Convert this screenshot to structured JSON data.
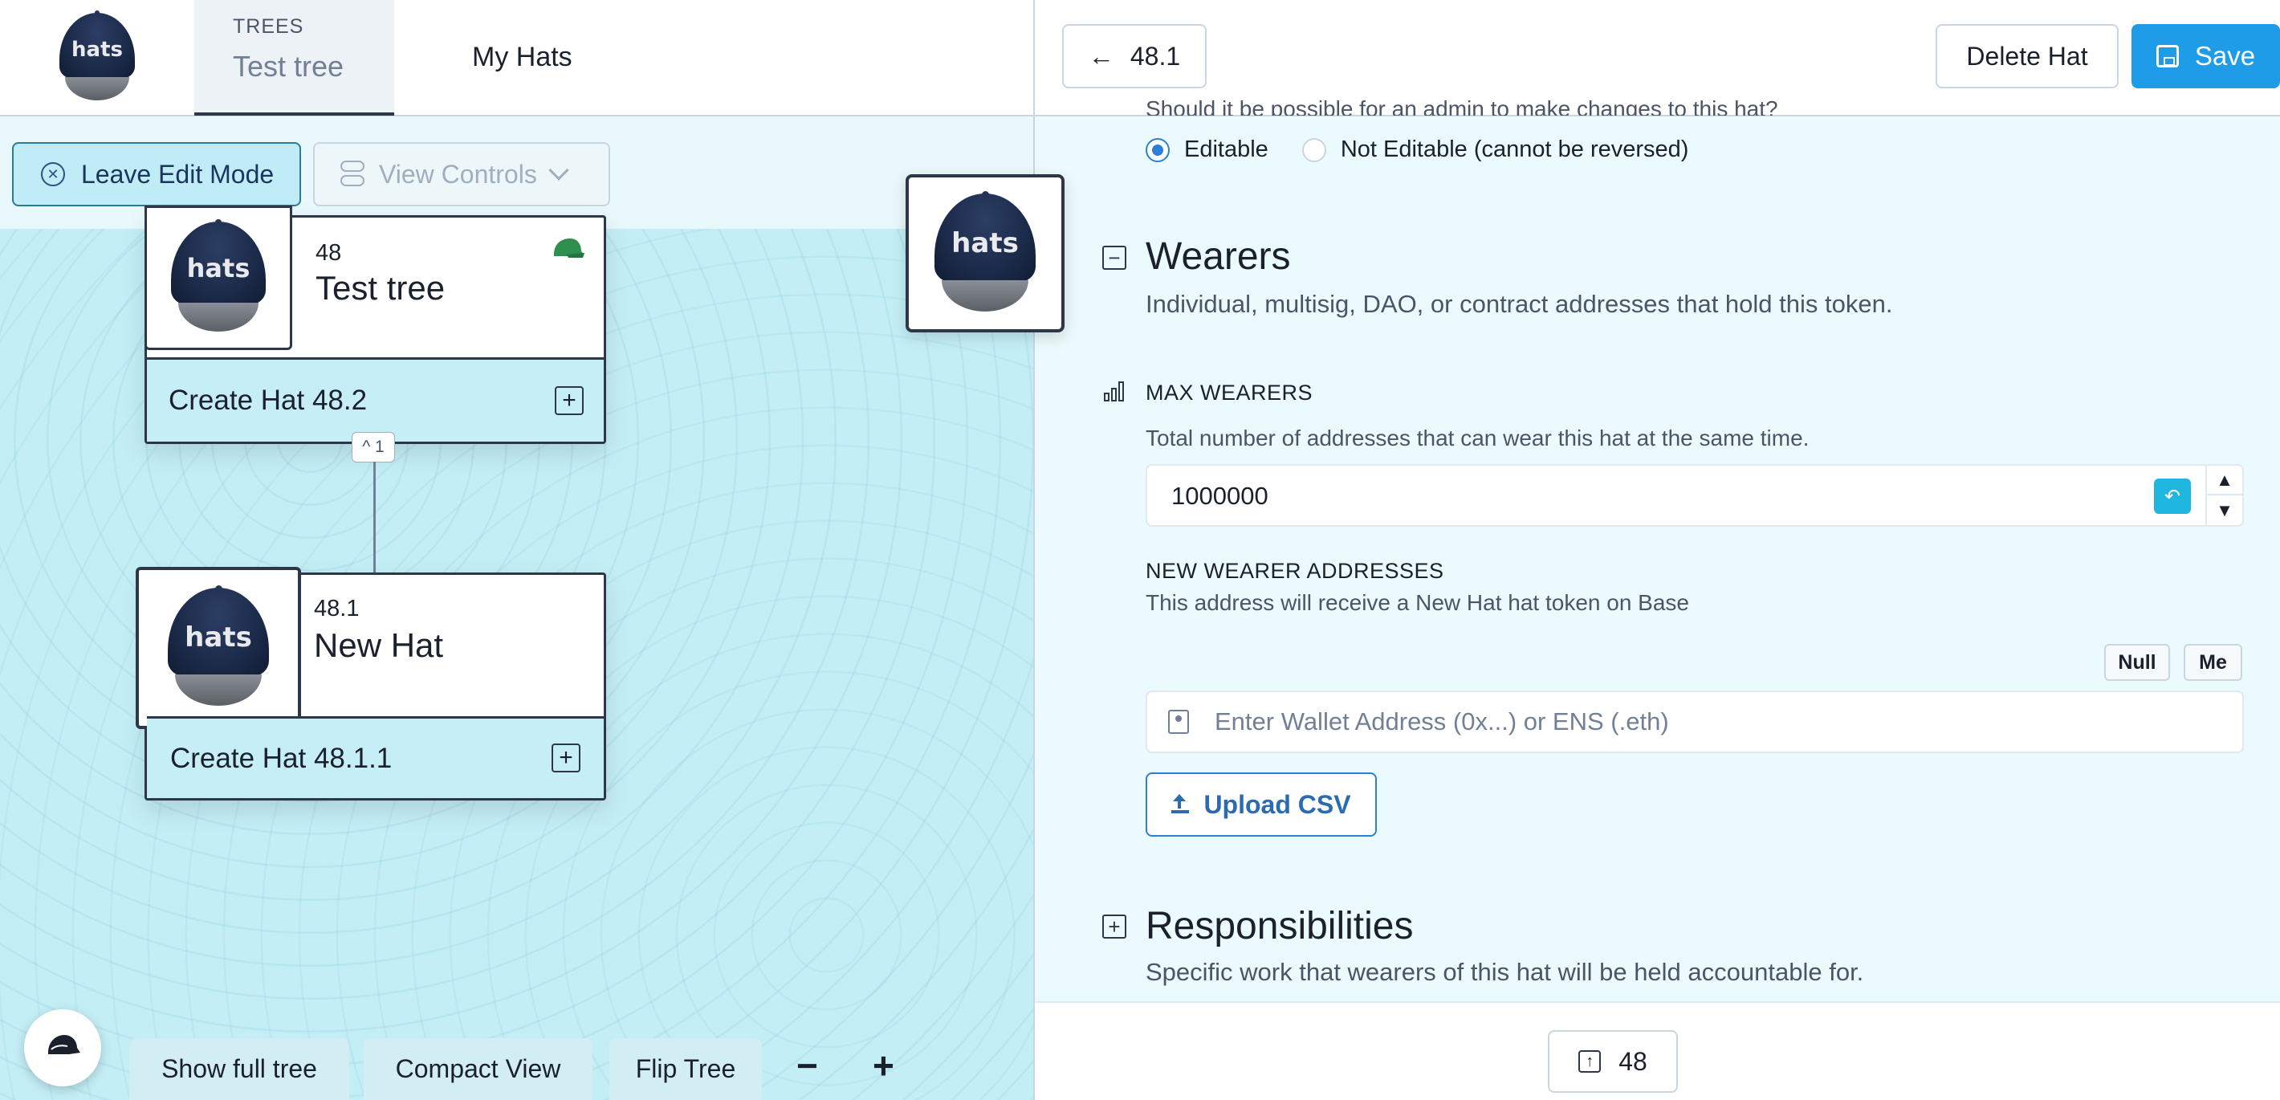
{
  "nav": {
    "logo_text": "hats",
    "trees_label": "TREES",
    "tree_name": "Test tree",
    "my_hats": "My Hats"
  },
  "toolbar": {
    "leave_edit": "Leave Edit Mode",
    "view_controls": "View Controls"
  },
  "tree": {
    "top_card": {
      "id": "48",
      "name": "Test tree",
      "create": "Create Hat 48.2",
      "logo_text": "hats"
    },
    "collapse_badge": "^ 1",
    "child_card": {
      "id": "48.1",
      "name": "New Hat",
      "create": "Create Hat 48.1.1",
      "logo_text": "hats"
    },
    "floating_logo_text": "hats"
  },
  "bottom_controls": {
    "show_full_tree": "Show full tree",
    "compact_view": "Compact View",
    "flip_tree": "Flip Tree",
    "zoom_out": "−",
    "zoom_in": "+"
  },
  "editor": {
    "back_label": "48.1",
    "delete_label": "Delete Hat",
    "save_label": "Save",
    "cut_text": "Should it be possible for an admin to make changes to this hat?",
    "radio_editable": "Editable",
    "radio_not_editable": "Not Editable (cannot be reversed)",
    "wearers": {
      "title": "Wearers",
      "subtitle": "Individual, multisig, DAO, or contract addresses that hold this token.",
      "max_label": "MAX WEARERS",
      "max_help": "Total number of addresses that can wear this hat at the same time.",
      "max_value": "1000000",
      "new_label": "NEW WEARER ADDRESSES",
      "new_help": "This address will receive a New Hat hat token on Base",
      "null_btn": "Null",
      "me_btn": "Me",
      "address_placeholder": "Enter Wallet Address (0x...) or ENS (.eth)",
      "upload_csv": "Upload CSV"
    },
    "responsibilities": {
      "title": "Responsibilities",
      "subtitle": "Specific work that wearers of this hat will be held accountable for."
    },
    "parent_label": "48"
  },
  "colors": {
    "accent": "#1f9ce8",
    "canvas": "#c4eef6",
    "panel": "#ebfafc",
    "card_border": "#2d3748"
  }
}
